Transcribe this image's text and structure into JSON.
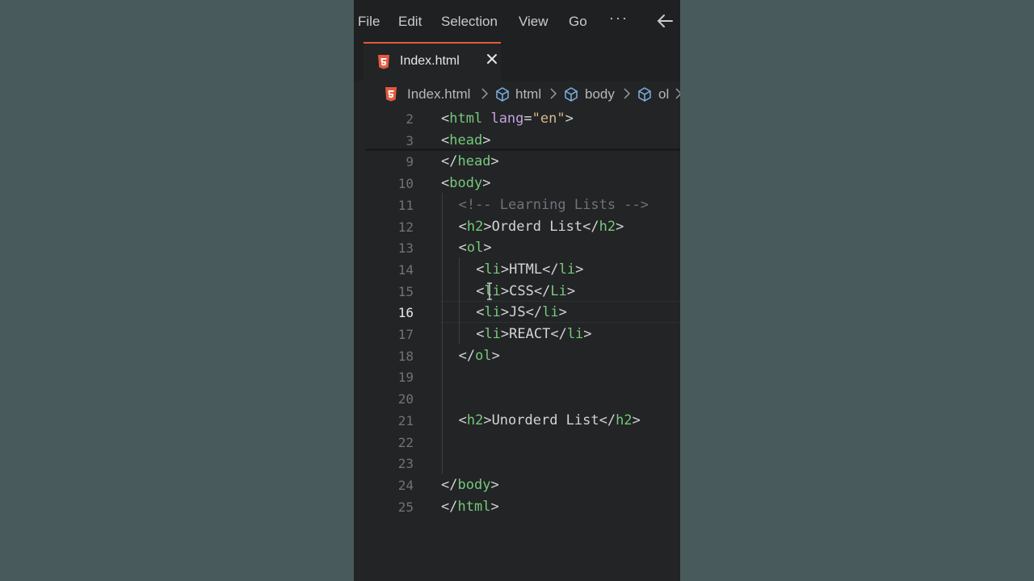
{
  "menu": [
    "File",
    "Edit",
    "Selection",
    "View",
    "Go",
    "···"
  ],
  "tab": {
    "title": "Index.html"
  },
  "breadcrumb": {
    "file": "Index.html",
    "parts": [
      "html",
      "body",
      "ol"
    ]
  },
  "code": {
    "active_line": "16",
    "lines": [
      {
        "n": "2",
        "text": "<html lang=\"en\">"
      },
      {
        "n": "3",
        "text": "<head>"
      },
      {
        "n": "9",
        "text": "</head>"
      },
      {
        "n": "10",
        "text": "<body>"
      },
      {
        "n": "11",
        "text": "<!-- Learning Lists -->"
      },
      {
        "n": "12",
        "text": "<h2>Orderd List</h2>"
      },
      {
        "n": "13",
        "text": "<ol>"
      },
      {
        "n": "14",
        "text": "<li>HTML</li>"
      },
      {
        "n": "15",
        "text": "<li>CSS</Li>"
      },
      {
        "n": "16",
        "text": "<li>JS</li>"
      },
      {
        "n": "17",
        "text": "<li>REACT</li>"
      },
      {
        "n": "18",
        "text": "</ol>"
      },
      {
        "n": "19",
        "text": ""
      },
      {
        "n": "20",
        "text": ""
      },
      {
        "n": "21",
        "text": "<h2>Unorderd List</h2>"
      },
      {
        "n": "22",
        "text": ""
      },
      {
        "n": "23",
        "text": ""
      },
      {
        "n": "24",
        "text": "</body>"
      },
      {
        "n": "25",
        "text": "</html>"
      }
    ]
  },
  "colors": {
    "accent": "#e35a3d",
    "tag": "#76c979",
    "attr": "#c7a1e0",
    "string": "#d7b98b",
    "comment": "#6e7479"
  }
}
